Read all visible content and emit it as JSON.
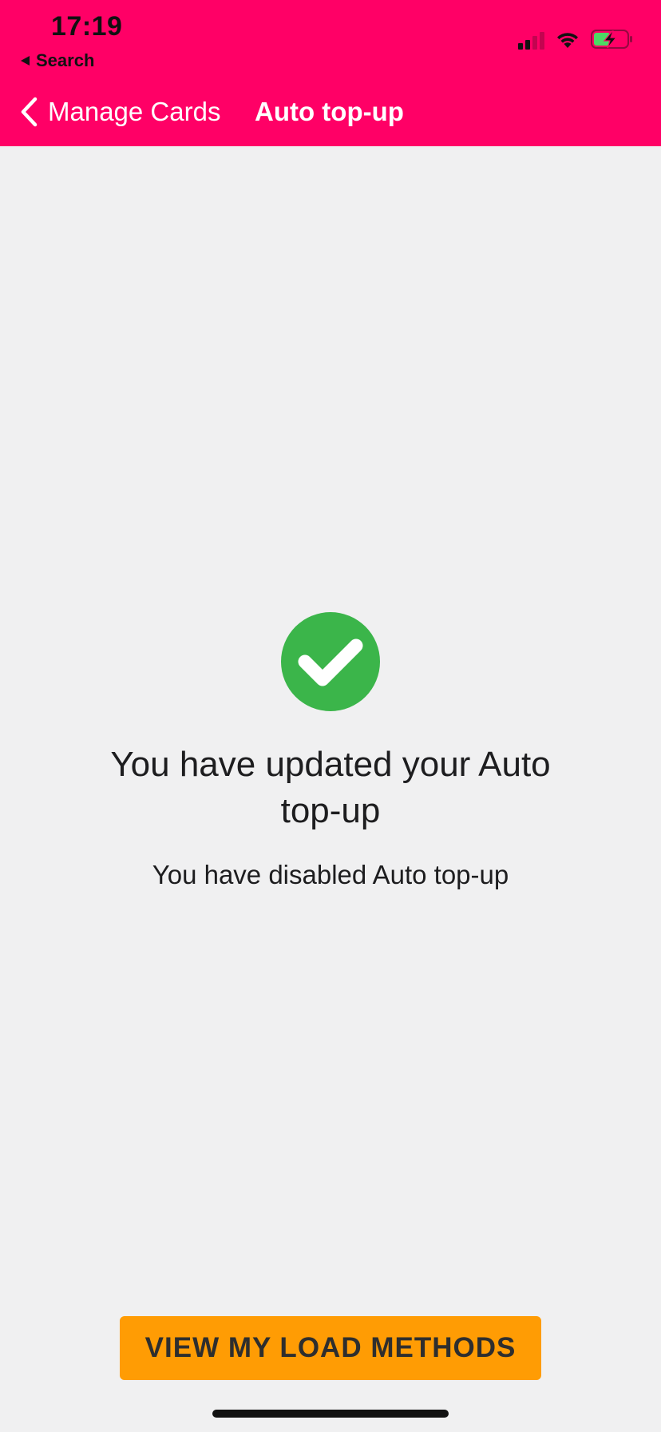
{
  "status_bar": {
    "time": "17:19",
    "back_app_label": "Search",
    "icons": [
      "signal-icon",
      "wifi-icon",
      "battery-charging-icon"
    ]
  },
  "nav": {
    "back_label": "Manage Cards",
    "title": "Auto top-up",
    "icons": [
      "chevron-left-icon"
    ]
  },
  "main": {
    "status_icon": "check-circle-icon",
    "headline": "You have updated your Auto top-up",
    "message": "You have disabled Auto top-up"
  },
  "footer": {
    "button_label": "VIEW MY LOAD METHODS"
  },
  "colors": {
    "header": "#ff0066",
    "background": "#f0f0f1",
    "success": "#3bb54a",
    "button": "#ff9c04",
    "button_text": "#2e2e2e"
  }
}
